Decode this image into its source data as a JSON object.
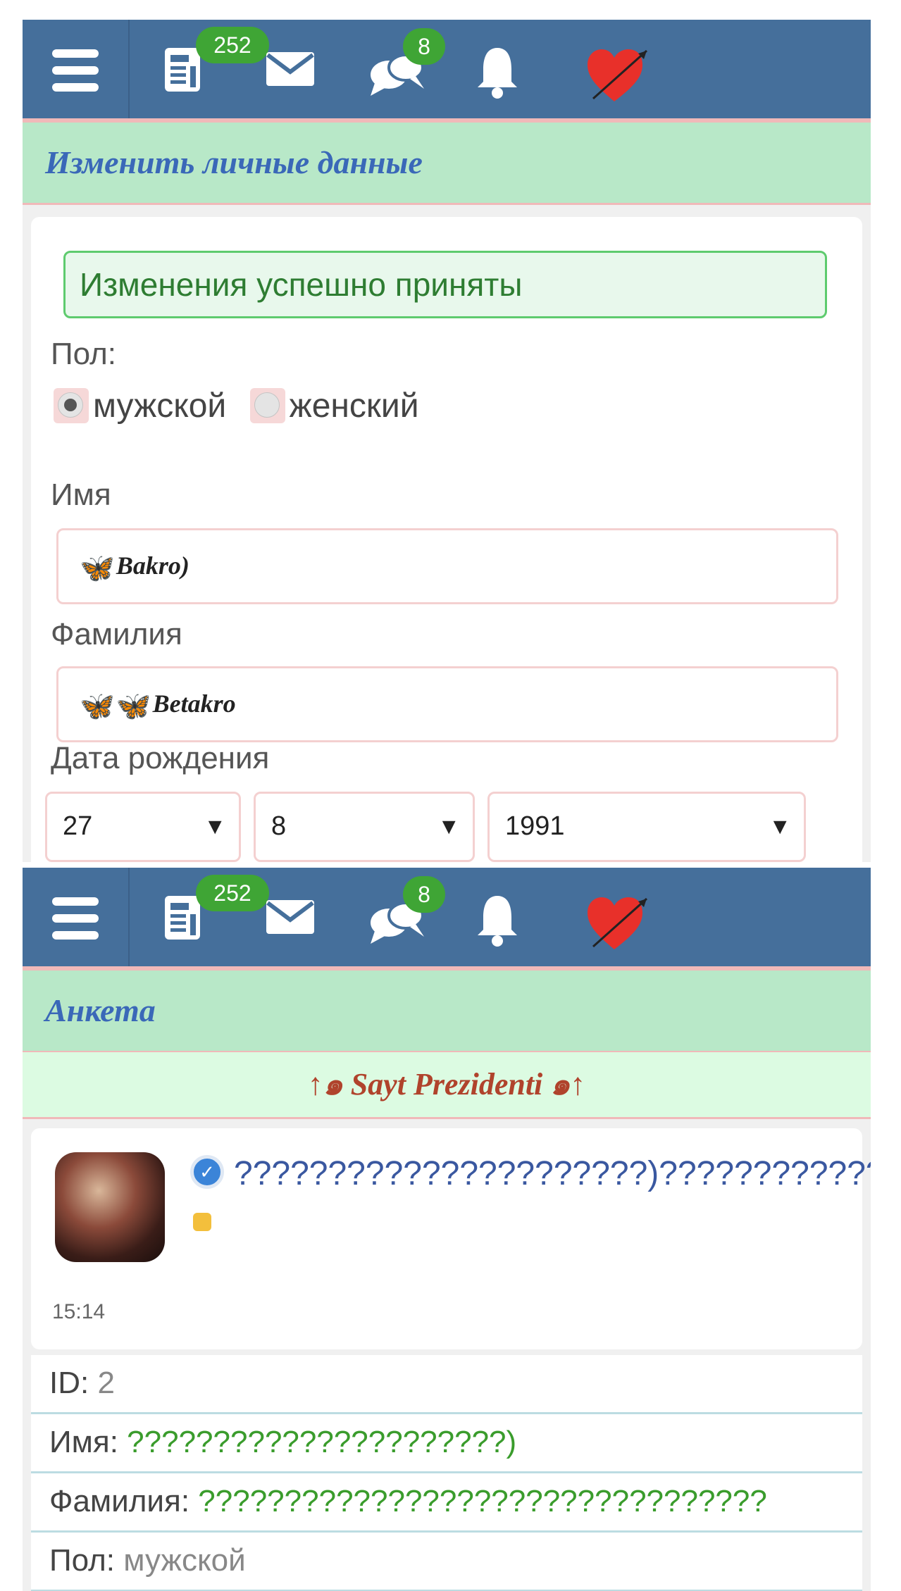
{
  "topbar": {
    "news_count": "252",
    "messages_count": "8",
    "accent_color": "#456f9b",
    "badge_color": "#3fa535",
    "icons": [
      "menu-icon",
      "news-icon",
      "mail-icon",
      "chat-icon",
      "bell-icon",
      "heart-icon"
    ]
  },
  "edit_screen": {
    "title": "Изменить личные данные",
    "alert": "Изменения успешно приняты",
    "gender_label": "Пол:",
    "gender_options": [
      "мужской",
      "женский"
    ],
    "gender_selected": "мужской",
    "first_name_label": "Имя",
    "first_name_value": "Bakro)",
    "last_name_label": "Фамилия",
    "last_name_value": "Betakro",
    "birthdate_label": "Дата рождения",
    "birth_day": "27",
    "birth_month": "8",
    "birth_year": "1991"
  },
  "profile_screen": {
    "title": "Анкета",
    "banner": "↑๑ Sayt Prezidenti ๑↑",
    "nickname": "??????????????????????)??????????????????????????????????",
    "time": "15:14",
    "rows": [
      {
        "key": "ID:",
        "value": "2"
      },
      {
        "key": "Имя:",
        "value": "??????????????????????)"
      },
      {
        "key": "Фамилия:",
        "value": "?????????????????????????????????"
      },
      {
        "key": "Пол:",
        "value": "мужской"
      }
    ]
  }
}
